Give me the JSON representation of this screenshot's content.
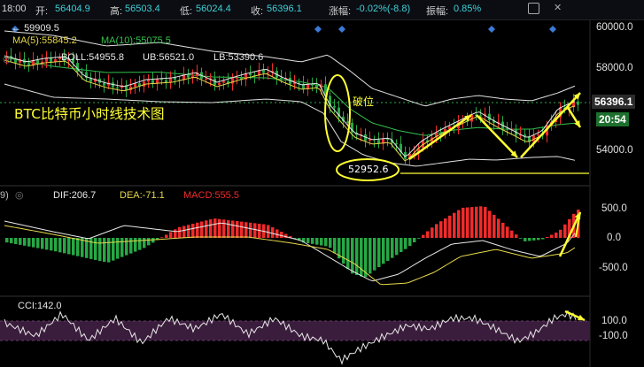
{
  "header": {
    "time": "18:00",
    "open_label": "开:",
    "open": "56404.9",
    "high_label": "高:",
    "high": "56503.4",
    "low_label": "低:",
    "low": "56024.4",
    "close_label": "收:",
    "close": "56396.1",
    "chg_label": "涨幅:",
    "chg": "-0.02%(-8.8)",
    "amp_label": "振幅:",
    "amp": "0.85%"
  },
  "main_panel": {
    "high_marker": "59909.5",
    "ma5": "MA(5):55845.2",
    "ma10": "MA(10):55075.5",
    "boll": "BOLL:54955.8",
    "ub": "UB:56521.0",
    "lb": "LB:53390.6",
    "y_ticks": [
      "60000.0",
      "58000.0",
      "56000.0",
      "54000.0"
    ],
    "current_price": "56396.1",
    "countdown": "20:54",
    "title": "BTC比特币小时线技术图",
    "break_label": "破位",
    "low_label": "52952.6"
  },
  "macd_panel": {
    "settings_prefix": "9)",
    "dif": "DIF:206.7",
    "dea": "DEA:-71.1",
    "macd": "MACD:555.5",
    "y_ticks": [
      "500.0",
      "0.0",
      "-500.0"
    ]
  },
  "cci_panel": {
    "cci": "CCI:142.0",
    "y_ticks": [
      "100.0",
      "-100.0"
    ]
  },
  "colors": {
    "up": "#ef2b2b",
    "down": "#27a845",
    "ma5": "#e8e8e8",
    "ma10": "#e6d84a",
    "boll": "#33c24d",
    "band": "#e0e0e0",
    "annotation": "#ffff33",
    "cci_band": "#3a1c3c"
  }
}
